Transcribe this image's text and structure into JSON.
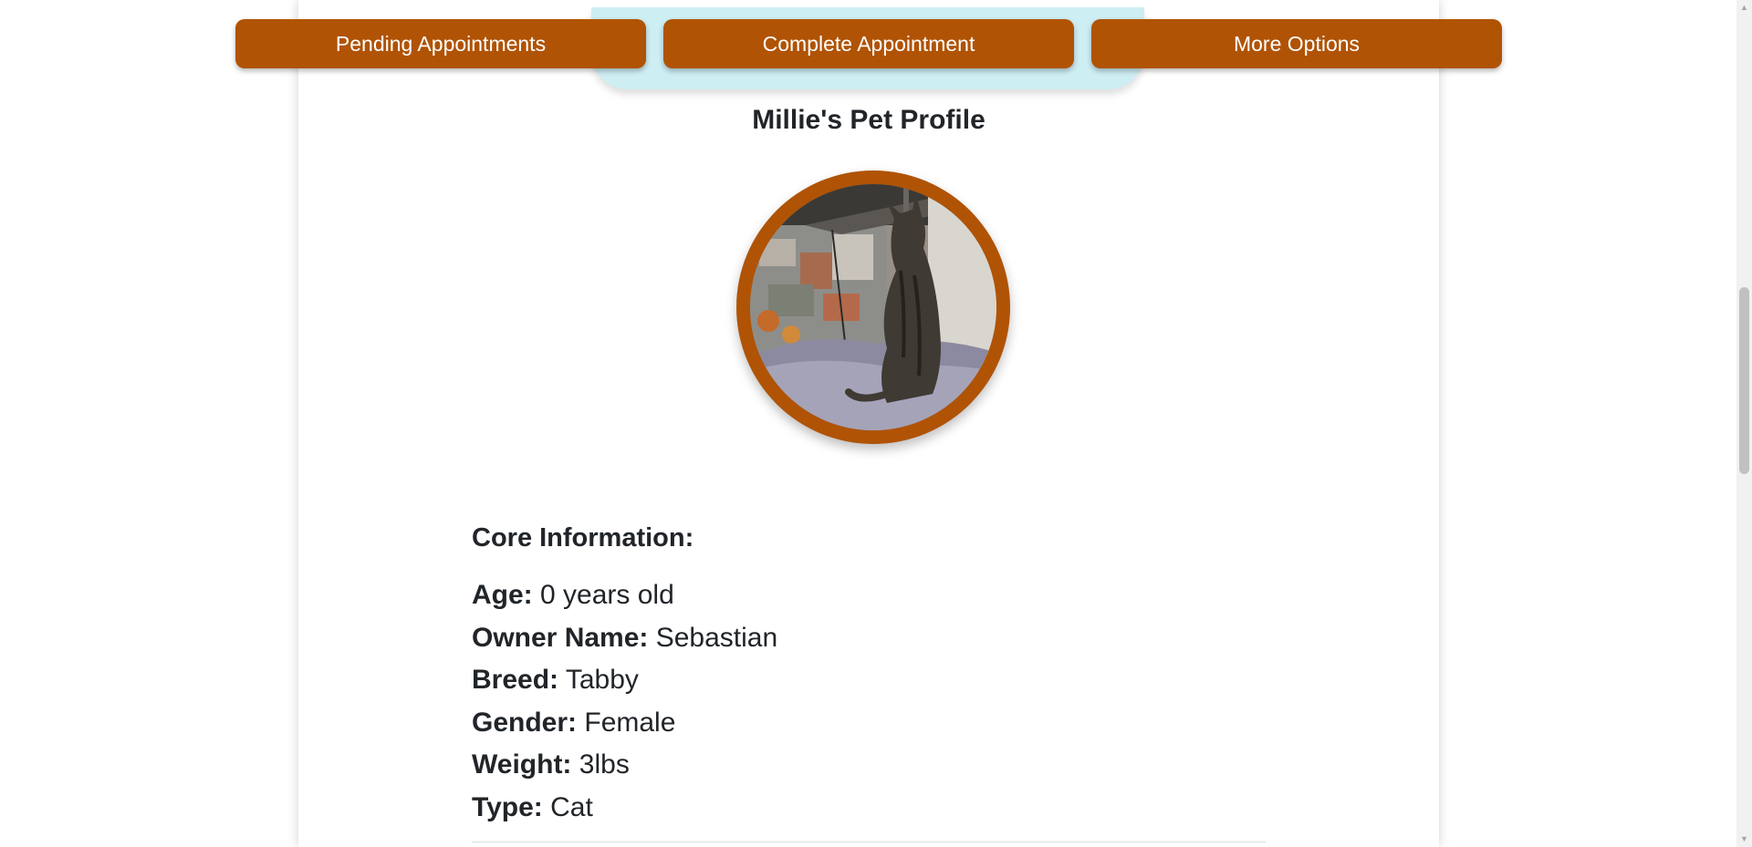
{
  "nav": {
    "buttons": [
      {
        "label": "Pending Appointments"
      },
      {
        "label": "Complete Appointment"
      },
      {
        "label": "More Options"
      }
    ]
  },
  "profile": {
    "title": "Millie's Pet Profile",
    "photo_alt": "Photo of Millie"
  },
  "core_info": {
    "heading": "Core Information:",
    "rows": [
      {
        "label": "Age:",
        "value": "0 years old"
      },
      {
        "label": "Owner Name:",
        "value": "Sebastian"
      },
      {
        "label": "Breed:",
        "value": "Tabby"
      },
      {
        "label": "Gender:",
        "value": "Female"
      },
      {
        "label": "Weight:",
        "value": "3lbs"
      },
      {
        "label": "Type:",
        "value": "Cat"
      }
    ]
  },
  "colors": {
    "accent": "#b05305",
    "highlight": "#cdeef3"
  },
  "scrollbar": {
    "up_icon": "▲",
    "down_icon": "▼"
  }
}
